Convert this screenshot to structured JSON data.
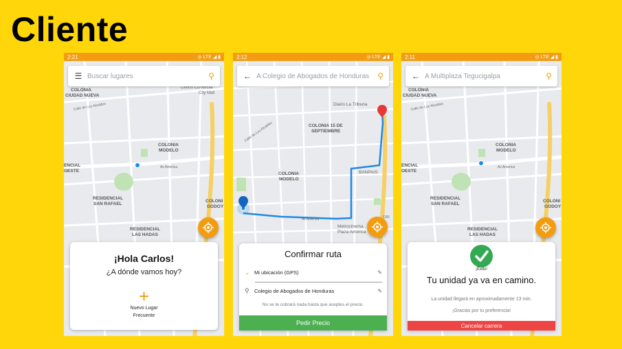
{
  "page": {
    "title": "Cliente"
  },
  "colors": {
    "brand": "#FFD60A",
    "accent": "#F39C12",
    "success": "#34A853",
    "primary_button": "#4CAF50",
    "danger": "#EF4444",
    "route": "#1E88E5"
  },
  "phone1": {
    "status": {
      "time": "2:21",
      "icons": "◎ LTE ◢ ▮"
    },
    "search": {
      "lead_icon": "menu-icon",
      "placeholder": "Buscar lugares"
    },
    "map_labels": {
      "colonia_ciudad_nueva": "COLONIA\nCIUDAD NUEVA",
      "centro_comercial": "Centro Comercial\nCity Mall",
      "calle_alcaldes": "Calle de Los Alcaldes",
      "colonia_modelo": "COLONIA\nMODELO",
      "av_america": "Av America",
      "encial_oeste": "ENCIAL\nOESTE",
      "residencial_san_rafael": "RESIDENCIAL\nSAN RAFAEL",
      "colonia_godoy": "COLONI\nGODOY",
      "residencial_las_hadas": "RESIDENCIAL\nLAS HADAS"
    },
    "card": {
      "greeting": "¡Hola Carlos!",
      "question": "¿A dónde vamos hoy?",
      "new_place_line1": "Nuevo Lugar",
      "new_place_line2": "Frecuente"
    }
  },
  "phone2": {
    "status": {
      "time": "2:12",
      "icons": "◎ LTE ◢ ▮"
    },
    "search": {
      "lead_icon": "arrow-back-icon",
      "value": "A Colegio de Abogados de Honduras"
    },
    "map_labels": {
      "diario": "Diario La Tribuna",
      "colonia_15": "COLONIA 15 DE\nSEPTIEMBRE",
      "calle": "Calle de Los Alcaldes",
      "colonia_modelo": "COLONIA\nMODELO",
      "banpais": "BANPAIS",
      "metrocinema": "Metrocinema\nPlaza América",
      "av_america": "Av America",
      "ca5": "CA5"
    },
    "card": {
      "title": "Confirmar ruta",
      "origin": "Mi ubicación (GPS)",
      "destination": "Colegio de Abogados de Honduras",
      "note": "No se te cobrará nada hasta que aceptes el precio.",
      "button": "Pedir Precio"
    }
  },
  "phone3": {
    "status": {
      "time": "2:11",
      "icons": "◎ LTE ◢ ▮"
    },
    "search": {
      "lead_icon": "arrow-back-icon",
      "value": "A Multiplaza Tegucigalpa"
    },
    "map_labels": {
      "colonia_ciudad_nueva": "COLONIA\nCIUDAD NUEVA",
      "calle_alcaldes": "Calle de Los Alcaldes",
      "colonia_modelo": "COLONIA\nMODELO",
      "av_america": "Av America",
      "encial_oeste": "ENCIAL\nOESTE",
      "residencial_san_rafael": "RESIDENCIAL\nSAN RAFAEL",
      "colonia_godoy": "COLONI\nGODOY",
      "residencial_las_hadas": "RESIDENCIAL\nLAS HADAS"
    },
    "card": {
      "exito": "¡Éxito!",
      "headline": "Tu unidad ya va en camino.",
      "eta": "La unidad llegará en aproximadamente 13 min.",
      "thanks": "¡Gracias por tu preferencia!",
      "cancel": "Cancelar carrera"
    }
  }
}
